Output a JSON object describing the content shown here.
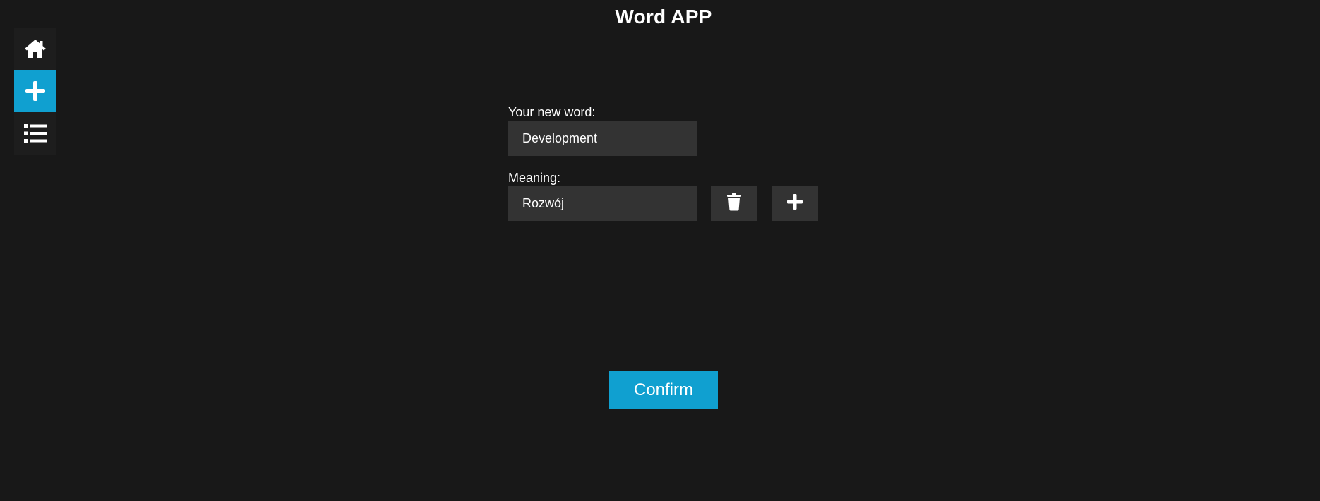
{
  "app": {
    "title": "Word APP",
    "accent_color": "#10a0d0"
  },
  "sidebar": {
    "items": [
      {
        "name": "home",
        "icon": "home-icon",
        "active": false
      },
      {
        "name": "add",
        "icon": "plus-icon",
        "active": true
      },
      {
        "name": "list",
        "icon": "list-icon",
        "active": false
      }
    ]
  },
  "form": {
    "word_label": "Your new word:",
    "word_value": "Development",
    "meaning_label": "Meaning:",
    "meaning_value": "Rozwój",
    "delete_icon": "trash-icon",
    "add_icon": "plus-icon",
    "confirm_label": "Confirm"
  }
}
